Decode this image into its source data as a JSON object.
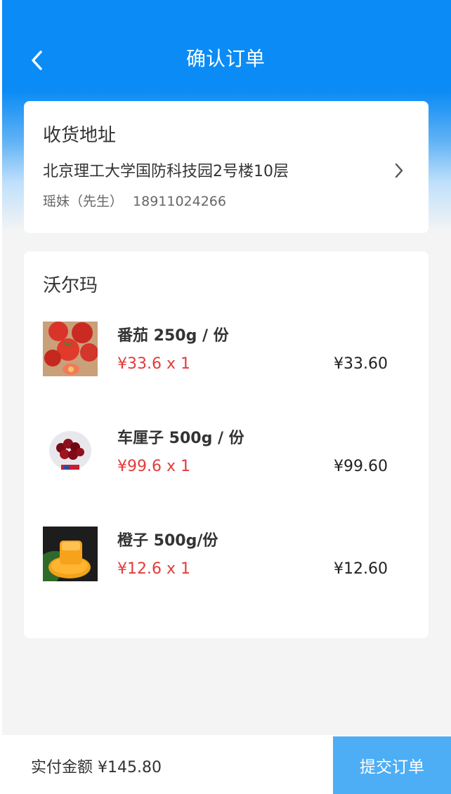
{
  "header": {
    "title": "确认订单"
  },
  "address": {
    "heading": "收货地址",
    "line": "北京理工大学国防科技园2号楼10层",
    "name": "瑶妹（先生）",
    "phone": "18911024266"
  },
  "order": {
    "store": "沃尔玛",
    "items": [
      {
        "name": "番茄 250g / 份",
        "unit_price": "¥33.6 x 1",
        "total": "¥33.60",
        "image": "tomato"
      },
      {
        "name": "车厘子 500g / 份",
        "unit_price": "¥99.6 x 1",
        "total": "¥99.60",
        "image": "cherry"
      },
      {
        "name": "橙子 500g/份",
        "unit_price": "¥12.6 x 1",
        "total": "¥12.60",
        "image": "orange"
      }
    ]
  },
  "footer": {
    "pay_label": "实付金额 ¥145.80",
    "submit_label": "提交订单"
  },
  "colors": {
    "header_blue": "#0b8bf5",
    "price_red": "#e23b3b",
    "submit_blue": "#4daef5"
  },
  "icons": {
    "back": "chevron-left-icon",
    "address_arrow": "chevron-right-icon"
  }
}
